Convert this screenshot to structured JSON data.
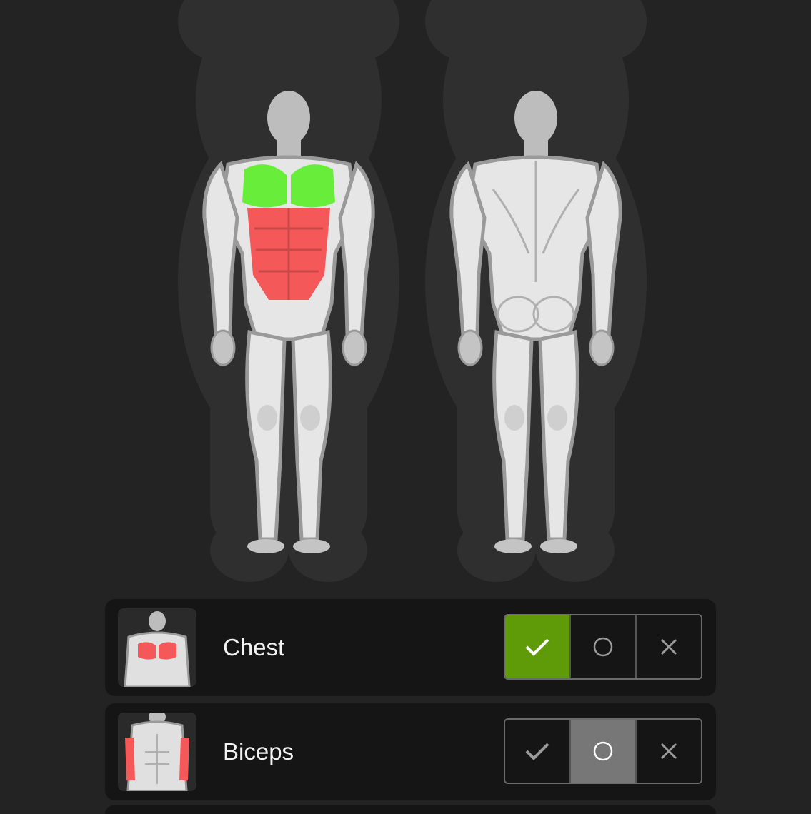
{
  "muscle_map": {
    "views": [
      "front",
      "back"
    ],
    "highlight_colors": {
      "selected": "#68ee3a",
      "neutral": "#f45858",
      "body": "#e6e6e6",
      "outline": "#9a9a9a"
    }
  },
  "rows": [
    {
      "label": "Chest",
      "thumbnail_icon": "chest-thumbnail-icon",
      "state": "yes"
    },
    {
      "label": "Biceps",
      "thumbnail_icon": "biceps-thumbnail-icon",
      "state": "maybe"
    }
  ],
  "segment_icons": [
    "checkmark-icon",
    "circle-icon",
    "x-icon"
  ],
  "colors": {
    "background": "#232323",
    "row_background": "#151515",
    "yes_active": "#5f9a08",
    "maybe_active": "#777777"
  }
}
